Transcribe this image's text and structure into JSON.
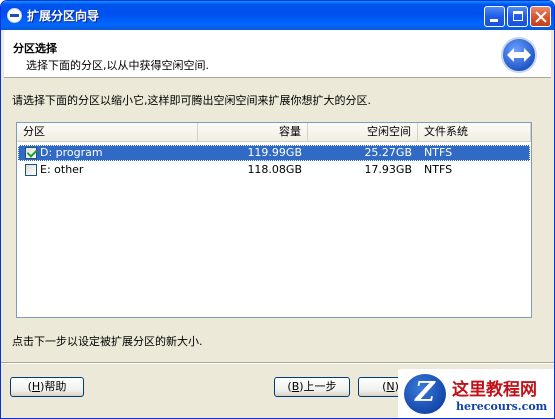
{
  "window": {
    "title": "扩展分区向导",
    "controls": {
      "minimize": "minimize-icon",
      "maximize": "maximize-icon",
      "close": "close-icon"
    }
  },
  "header": {
    "title": "分区选择",
    "subtitle": "选择下面的分区,以从中获得空闲空间."
  },
  "instruction": "请选择下面的分区以缩小它,这样即可腾出空闲空间来扩展你想扩大的分区.",
  "table": {
    "columns": [
      "分区",
      "容量",
      "空闲空间",
      "文件系统"
    ],
    "rows": [
      {
        "checked": true,
        "name": "D: program",
        "capacity": "119.99GB",
        "free": "25.27GB",
        "fs": "NTFS",
        "selected": true
      },
      {
        "checked": false,
        "name": "E: other",
        "capacity": "118.08GB",
        "free": "17.93GB",
        "fs": "NTFS",
        "selected": false
      }
    ]
  },
  "footnote": "点击下一步以设定被扩展分区的新大小.",
  "buttons": {
    "help": {
      "pre": "(",
      "key": "H",
      "post": ")帮助"
    },
    "back": {
      "pre": "(",
      "key": "B",
      "post": ")上一步"
    },
    "next": {
      "pre": "(",
      "key": "N",
      "post": ")下"
    }
  },
  "watermark": {
    "logo_letter": "Z",
    "title": "这里教程网",
    "url": "herecours.com"
  },
  "colors": {
    "titlebar": "#0054e3",
    "selection": "#316ac5",
    "window_bg": "#ece9d8",
    "watermark_red": "#c1121a",
    "watermark_blue": "#1244a8"
  }
}
